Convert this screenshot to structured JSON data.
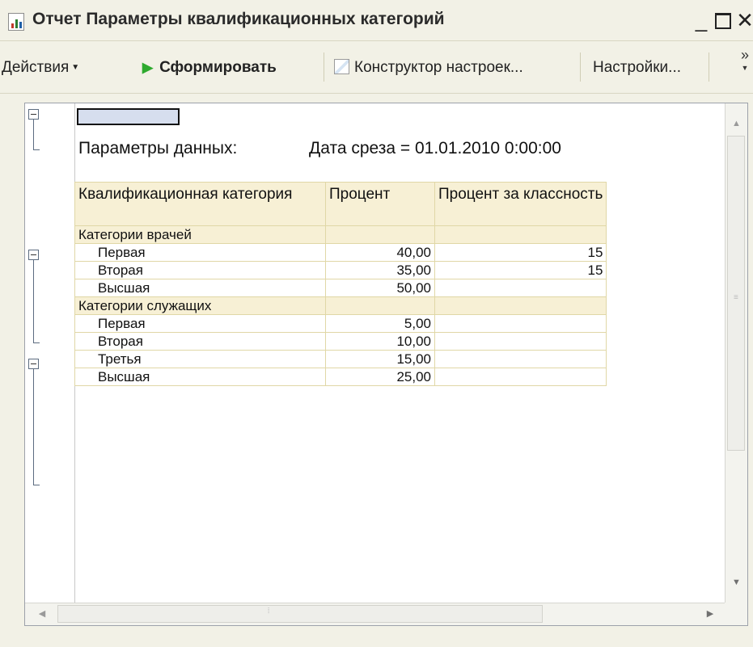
{
  "window": {
    "title": "Отчет  Параметры квалификационных категорий",
    "icon": "report-icon",
    "minimize_glyph": "_",
    "close_glyph": "✕"
  },
  "toolbar": {
    "actions_label": "Действия",
    "form_label": "Сформировать",
    "constructor_label": "Конструктор настроек...",
    "settings_label": "Настройки...",
    "more_glyph": "»"
  },
  "report": {
    "params_label": "Параметры данных:",
    "params_value": "Дата среза = 01.01.2010 0:00:00",
    "columns": [
      "Квалификационная категория",
      "Процент",
      "Процент за классность"
    ],
    "groups": [
      {
        "name": "Категории врачей",
        "rows": [
          {
            "name": "Первая",
            "percent": "40,00",
            "class_percent": "15"
          },
          {
            "name": "Вторая",
            "percent": "35,00",
            "class_percent": "15"
          },
          {
            "name": "Высшая",
            "percent": "50,00",
            "class_percent": ""
          }
        ]
      },
      {
        "name": "Категории служащих",
        "rows": [
          {
            "name": "Первая",
            "percent": "5,00",
            "class_percent": ""
          },
          {
            "name": "Вторая",
            "percent": "10,00",
            "class_percent": ""
          },
          {
            "name": "Третья",
            "percent": "15,00",
            "class_percent": ""
          },
          {
            "name": "Высшая",
            "percent": "25,00",
            "class_percent": ""
          }
        ]
      }
    ]
  },
  "colors": {
    "header_bg": "#f7f0d5",
    "grid_border": "#e0d7a6",
    "selection": "#d6deee",
    "chrome": "#f2f1e6"
  }
}
